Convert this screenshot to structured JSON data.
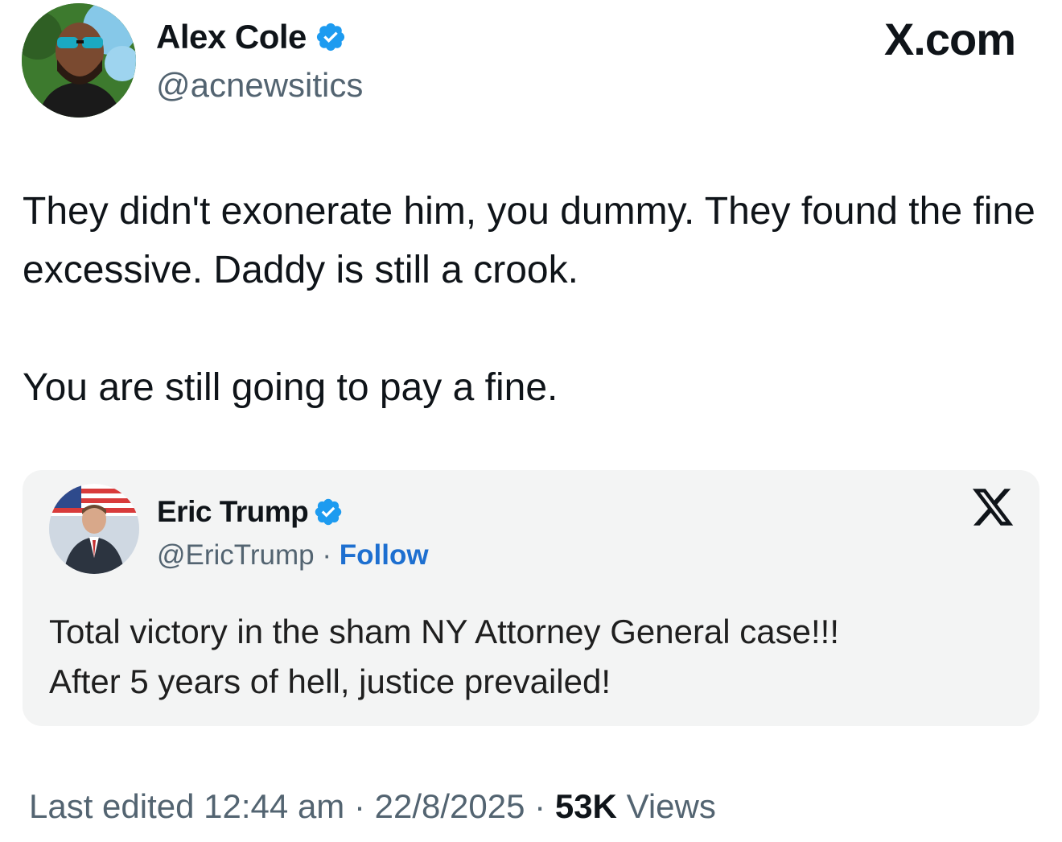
{
  "author": {
    "name": "Alex Cole",
    "handle": "@acnewsitics",
    "verified": true
  },
  "site_label": "X.com",
  "tweet": {
    "paragraphs": [
      "They didn't exonerate him, you dummy. They found the fine excessive. Daddy is still a crook.",
      "You are still going to pay a fine."
    ]
  },
  "quoted": {
    "name": "Eric Trump",
    "handle": "@EricTrump",
    "separator": "·",
    "follow_label": "Follow",
    "verified": true,
    "text_lines": [
      "Total victory in the sham NY Attorney General case!!!",
      "After 5 years of hell, justice prevailed!"
    ]
  },
  "footer": {
    "edited_label": "Last edited",
    "time": "12:44 am",
    "sep1": "·",
    "date": "22/8/2025",
    "sep2": "·",
    "views_count": "53K",
    "views_label": "Views"
  },
  "colors": {
    "verified_blue": "#1d9bf0",
    "follow_blue": "#1d6fd0",
    "secondary_text": "#536471",
    "quote_background": "#f3f4f4"
  },
  "icons": [
    "verified-badge-icon",
    "x-logo-icon"
  ]
}
